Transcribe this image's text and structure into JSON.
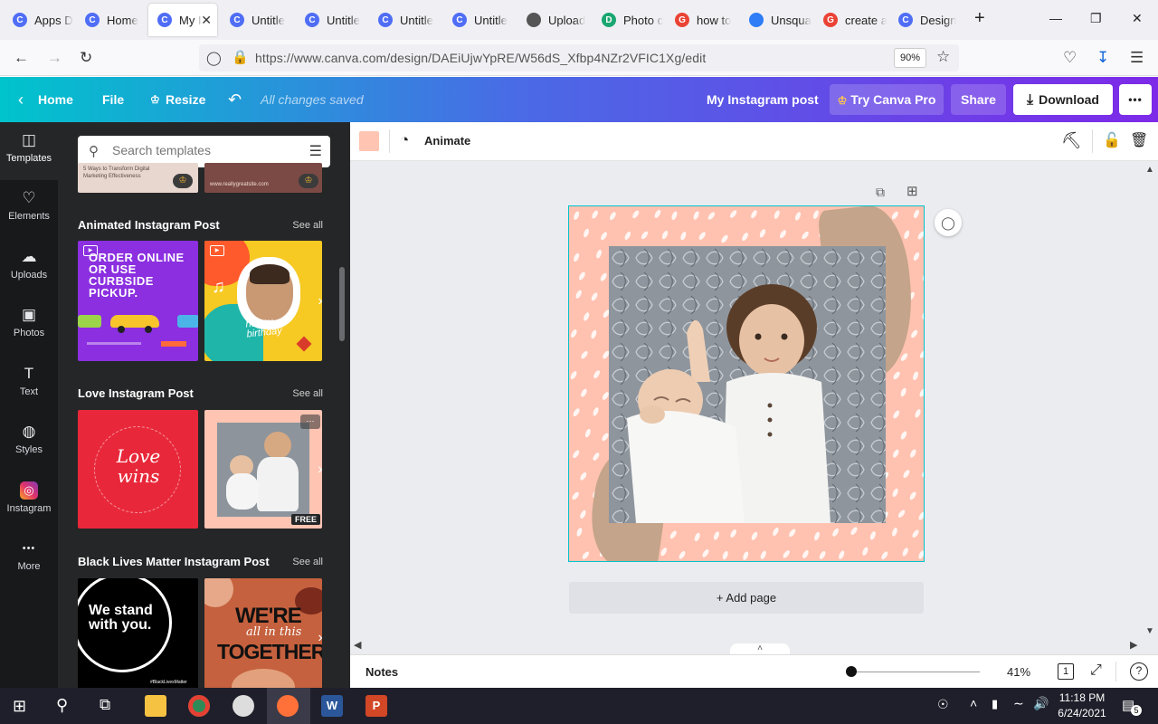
{
  "browser": {
    "tabs": [
      {
        "title": "Apps D",
        "favicon": "canva-icon",
        "color": "#4f6df5"
      },
      {
        "title": "Home",
        "favicon": "canva-icon",
        "color": "#4f6df5"
      },
      {
        "title": "My I",
        "favicon": "canva-icon",
        "color": "#4f6df5",
        "active": true
      },
      {
        "title": "Untitle",
        "favicon": "canva-icon",
        "color": "#4f6df5"
      },
      {
        "title": "Untitle",
        "favicon": "canva-icon",
        "color": "#4f6df5"
      },
      {
        "title": "Untitle",
        "favicon": "canva-icon",
        "color": "#4f6df5"
      },
      {
        "title": "Untitle",
        "favicon": "canva-icon",
        "color": "#4f6df5"
      },
      {
        "title": "Upload",
        "favicon": "layers-icon",
        "color": "#555555"
      },
      {
        "title": "Photo c",
        "favicon": "doc-icon",
        "color": "#1ba672"
      },
      {
        "title": "how to",
        "favicon": "google-icon",
        "color": "#ea4335"
      },
      {
        "title": "Unsqua",
        "favicon": "unsquare-icon",
        "color": "#2e7df6"
      },
      {
        "title": "create a",
        "favicon": "google-icon",
        "color": "#ea4335"
      },
      {
        "title": "Design",
        "favicon": "canva-icon",
        "color": "#4f6df5"
      }
    ],
    "new_tab": "+",
    "url": "https://www.canva.com/design/DAEiUjwYpRE/W56dS_Xfbp4NZr2VFIC1Xg/edit",
    "zoom": "90%"
  },
  "canva_header": {
    "home": "Home",
    "file": "File",
    "resize": "Resize",
    "status": "All changes saved",
    "doc_title": "My Instagram post",
    "try_pro": "Try Canva Pro",
    "share": "Share",
    "download": "Download",
    "more": "•••"
  },
  "rail": [
    {
      "label": "Templates",
      "icon": "templates-icon",
      "active": true
    },
    {
      "label": "Elements",
      "icon": "elements-icon"
    },
    {
      "label": "Uploads",
      "icon": "uploads-icon"
    },
    {
      "label": "Photos",
      "icon": "photos-icon"
    },
    {
      "label": "Text",
      "icon": "text-icon"
    },
    {
      "label": "Styles",
      "icon": "styles-icon"
    },
    {
      "label": "Instagram",
      "icon": "instagram-icon"
    },
    {
      "label": "More",
      "icon": "more-icon"
    }
  ],
  "panel": {
    "search_placeholder": "Search templates",
    "top_cards": {
      "left_text": "5 Ways to Transform Digital Marketing Effectiveness",
      "right_text": "www.reallygreatsite.com"
    },
    "sections": [
      {
        "title": "Animated Instagram Post",
        "see_all": "See all",
        "card1_text": "ORDER ONLINE OR USE CURBSIDE PICKUP.",
        "card2_text": "happy birthday"
      },
      {
        "title": "Love Instagram Post",
        "see_all": "See all",
        "card1_text": "Love wins",
        "card2_badge": "FREE"
      },
      {
        "title": "Black Lives Matter Instagram Post",
        "see_all": "See all",
        "card1_text": "We stand with you.",
        "card1_tag": "#BlackLivesMatter",
        "card2_text_a": "WE'RE",
        "card2_text_b": "all in this",
        "card2_text_c": "TOGETHER"
      }
    ]
  },
  "toolbar": {
    "animate": "Animate",
    "swatch_color": "#ffc4b2"
  },
  "canvas": {
    "add_page": "+ Add page"
  },
  "bottom": {
    "notes": "Notes",
    "zoom": "41%",
    "page_count": "1",
    "help": "?"
  },
  "taskbar": {
    "time": "11:18 PM",
    "date": "6/24/2021",
    "notifications": "5"
  }
}
